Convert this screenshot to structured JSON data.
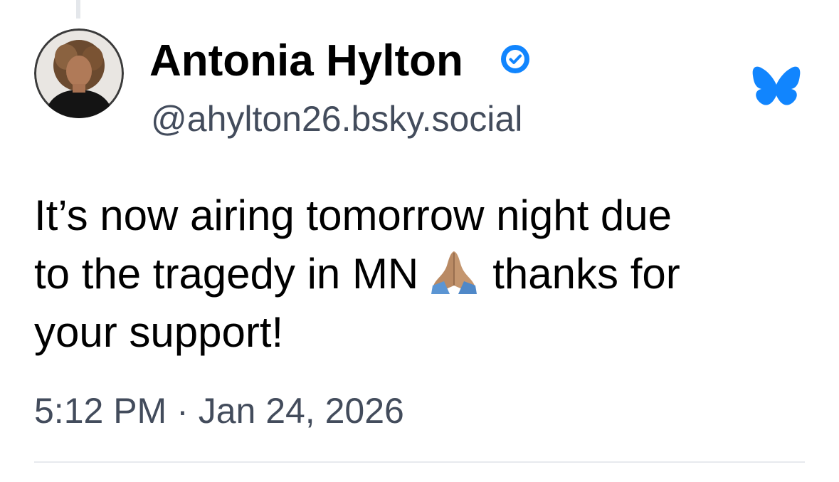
{
  "author": {
    "name": "Antonia Hylton",
    "handle": "@ahylton26.bsky.social",
    "verified": true,
    "avatar_icon": "profile-photo"
  },
  "post": {
    "lines": [
      "It’s now airing tomorrow night due",
      "to the tragedy in MN",
      "thanks for",
      "your support!"
    ],
    "emoji": "🙏🏽"
  },
  "timestamp": {
    "time": "5:12 PM",
    "separator": "·",
    "date": "Jan 24, 2026"
  },
  "icons": {
    "verified": "verified-check-icon",
    "platform": "bluesky-butterfly-icon",
    "emoji": "folded-hands-emoji"
  },
  "colors": {
    "brand_blue": "#1185fe",
    "handle_gray": "#434c5c",
    "text": "#000000"
  }
}
